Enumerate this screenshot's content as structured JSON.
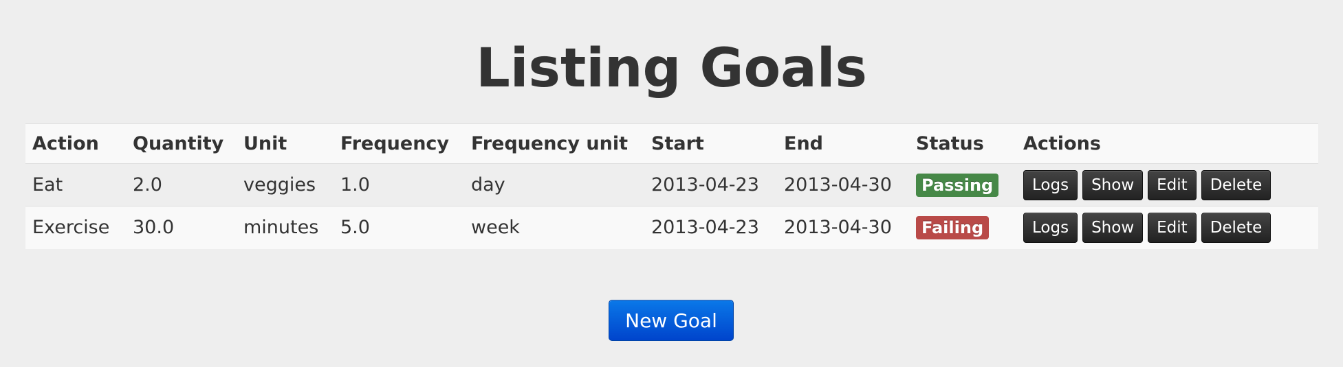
{
  "page": {
    "title": "Listing Goals"
  },
  "table": {
    "headers": {
      "action": "Action",
      "quantity": "Quantity",
      "unit": "Unit",
      "frequency": "Frequency",
      "frequency_unit": "Frequency unit",
      "start": "Start",
      "end": "End",
      "status": "Status",
      "actions": "Actions"
    },
    "rows": [
      {
        "action": "Eat",
        "quantity": "2.0",
        "unit": "veggies",
        "frequency": "1.0",
        "frequency_unit": "day",
        "start": "2013-04-23",
        "end": "2013-04-30",
        "status": "Passing",
        "status_color": "#468847"
      },
      {
        "action": "Exercise",
        "quantity": "30.0",
        "unit": "minutes",
        "frequency": "5.0",
        "frequency_unit": "week",
        "start": "2013-04-23",
        "end": "2013-04-30",
        "status": "Failing",
        "status_color": "#b94a48"
      }
    ],
    "row_actions": {
      "logs": "Logs",
      "show": "Show",
      "edit": "Edit",
      "delete": "Delete"
    }
  },
  "new_goal_label": "New Goal",
  "colors": {
    "background": "#eeeeee",
    "primary_button": "#0044cc",
    "dark_button": "#222222"
  }
}
